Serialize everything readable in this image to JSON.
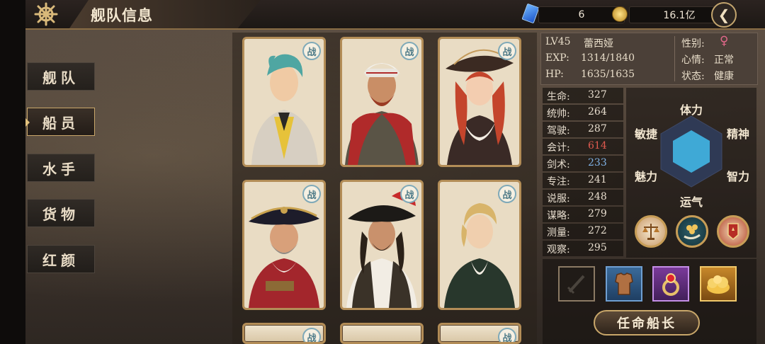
{
  "header": {
    "title": "舰队信息",
    "gems": "6",
    "gold": "16.1亿",
    "helm_icon": "helm-icon",
    "back_icon": "back-icon"
  },
  "sidebar": {
    "items": [
      {
        "label": "舰队",
        "active": false
      },
      {
        "label": "船员",
        "active": true
      },
      {
        "label": "水手",
        "active": false
      },
      {
        "label": "货物",
        "active": false
      },
      {
        "label": "红颜",
        "active": false
      }
    ]
  },
  "crew": {
    "badge": "战",
    "cards": [
      {
        "portrait": "teal-haired-officer"
      },
      {
        "portrait": "turbaned-bearded-captain"
      },
      {
        "portrait": "red-haired-pirate-woman"
      },
      {
        "portrait": "gray-bearded-admiral"
      },
      {
        "portrait": "dreadlocked-pirate"
      },
      {
        "portrait": "blond-gentleman"
      }
    ]
  },
  "info": {
    "level": "LV45",
    "name": "蕾西娅",
    "exp_label": "EXP:",
    "exp_value": "1314/1840",
    "hp_label": "HP:",
    "hp_value": "1635/1635",
    "gender_label": "性别:",
    "gender_symbol": "♀",
    "mood_label": "心情:",
    "mood_value": "正常",
    "status_label": "状态:",
    "status_value": "健康"
  },
  "stats": [
    {
      "label": "生命:",
      "value": "327",
      "color": "#e6dccd"
    },
    {
      "label": "统帅:",
      "value": "264",
      "color": "#e6dccd"
    },
    {
      "label": "驾驶:",
      "value": "287",
      "color": "#e6dccd"
    },
    {
      "label": "会计:",
      "value": "614",
      "color": "#e05a4f"
    },
    {
      "label": "剑术:",
      "value": "233",
      "color": "#7fb2e6"
    },
    {
      "label": "专注:",
      "value": "241",
      "color": "#e6dccd"
    },
    {
      "label": "说服:",
      "value": "248",
      "color": "#e6dccd"
    },
    {
      "label": "谋略:",
      "value": "279",
      "color": "#e6dccd"
    },
    {
      "label": "测量:",
      "value": "272",
      "color": "#e6dccd"
    },
    {
      "label": "观察:",
      "value": "295",
      "color": "#e6dccd"
    }
  ],
  "radar": {
    "labels": {
      "top": "体力",
      "top_right": "精神",
      "bottom_right": "智力",
      "bottom": "运气",
      "bottom_left": "魅力",
      "top_left": "敏捷"
    },
    "fill_color": "#3fa9d6"
  },
  "skills": [
    {
      "icon": "scales-icon"
    },
    {
      "icon": "coins-hand-icon"
    },
    {
      "icon": "flag-emblem-icon"
    }
  ],
  "equipment": [
    {
      "icon": "sword-slot-icon",
      "empty": true
    },
    {
      "icon": "armor-icon",
      "empty": false
    },
    {
      "icon": "ring-icon",
      "empty": false
    },
    {
      "icon": "gold-treasure-icon",
      "empty": false
    }
  ],
  "actions": {
    "appoint_captain": "任命船长"
  }
}
